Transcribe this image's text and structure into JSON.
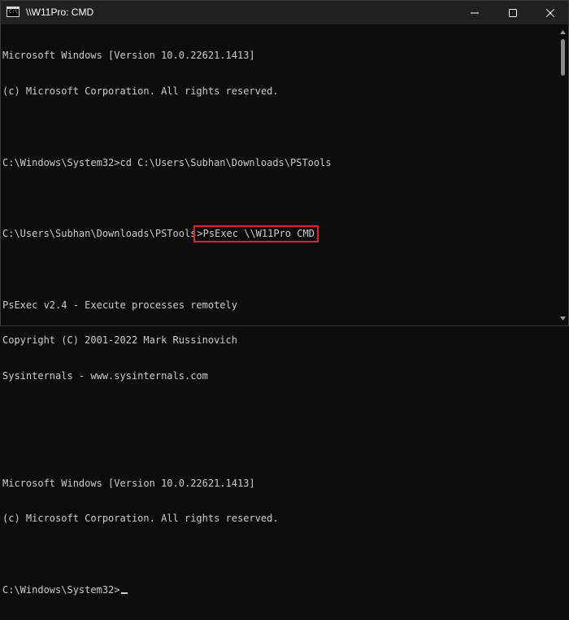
{
  "window": {
    "title": "\\\\W11Pro: CMD",
    "icon": "terminal-icon",
    "controls": [
      "minimize-icon",
      "maximize-icon",
      "close-icon"
    ]
  },
  "console": {
    "lines": [
      "Microsoft Windows [Version 10.0.22621.1413]",
      "(c) Microsoft Corporation. All rights reserved.",
      "",
      "C:\\Windows\\System32>cd C:\\Users\\Subhan\\Downloads\\PSTools",
      "",
      "C:\\Users\\Subhan\\Downloads\\PSTools",
      "",
      "PsExec v2.4 - Execute processes remotely",
      "Copyright (C) 2001-2022 Mark Russinovich",
      "Sysinternals - www.sysinternals.com",
      "",
      "",
      "Microsoft Windows [Version 10.0.22621.1413]",
      "(c) Microsoft Corporation. All rights reserved.",
      "",
      "C:\\Windows\\System32>"
    ],
    "highlighted_command": ">PsExec \\\\W11Pro CMD",
    "highlight_color": "#e0222a",
    "text_color": "#cccccc",
    "background_color": "#0c0c0c"
  }
}
